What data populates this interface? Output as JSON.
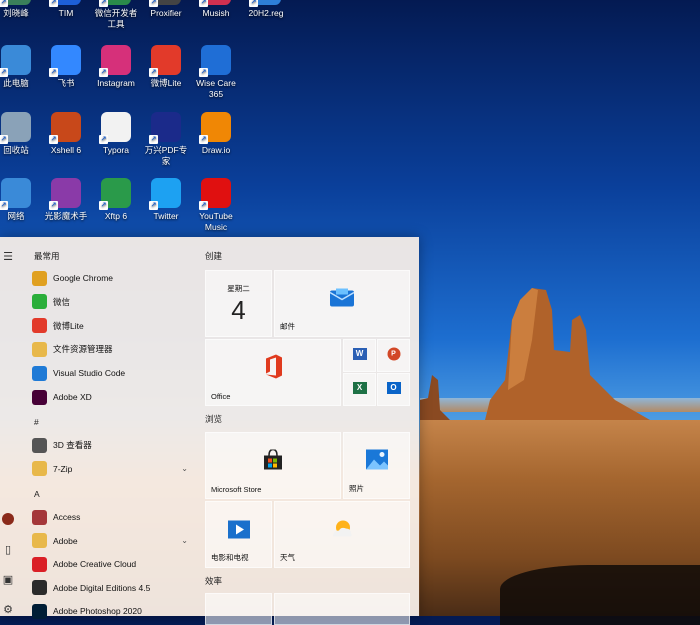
{
  "desktop": {
    "icons": [
      {
        "label": "刘晓峰",
        "icon": "user-folder-icon",
        "color": "#3a7f5a"
      },
      {
        "label": "TIM",
        "icon": "tim-icon",
        "color": "#1d5fd8"
      },
      {
        "label": "微信开发者工具",
        "icon": "wechat-devtools-icon",
        "color": "#2a8a4a"
      },
      {
        "label": "Proxifier",
        "icon": "proxifier-icon",
        "color": "#444444"
      },
      {
        "label": "Musish",
        "icon": "musish-icon",
        "color": "#d03050"
      },
      {
        "label": "20H2.reg",
        "icon": "reg-file-icon",
        "color": "#2e7fd8"
      },
      {
        "label": "此电脑",
        "icon": "computer-icon",
        "color": "#3a8ad8"
      },
      {
        "label": "飞书",
        "icon": "feishu-icon",
        "color": "#3388ff"
      },
      {
        "label": "Instagram",
        "icon": "instagram-icon",
        "color": "#d6307a"
      },
      {
        "label": "微博Lite",
        "icon": "weibo-icon",
        "color": "#e23a2a"
      },
      {
        "label": "Wise Care 365",
        "icon": "wise-care-icon",
        "color": "#1f6ed6"
      },
      {
        "label": "回收站",
        "icon": "recycle-bin-icon",
        "color": "#8aa2b8"
      },
      {
        "label": "Xshell 6",
        "icon": "xshell-icon",
        "color": "#c8481a"
      },
      {
        "label": "Typora",
        "icon": "typora-icon",
        "color": "#f2f2f2"
      },
      {
        "label": "万兴PDF专家",
        "icon": "pdf-icon",
        "color": "#1b2a8a"
      },
      {
        "label": "Draw.io",
        "icon": "drawio-icon",
        "color": "#f08705"
      },
      {
        "label": "网络",
        "icon": "network-icon",
        "color": "#3a8ad8"
      },
      {
        "label": "光影魔术手",
        "icon": "neoimaging-icon",
        "color": "#8a3aa8"
      },
      {
        "label": "Xftp 6",
        "icon": "xftp-icon",
        "color": "#2a9a4a"
      },
      {
        "label": "Twitter",
        "icon": "twitter-icon",
        "color": "#1da1f2"
      },
      {
        "label": "YouTube Music",
        "icon": "youtube-music-icon",
        "color": "#e01010"
      }
    ]
  },
  "start_menu": {
    "section_frequent": "最常用",
    "frequent": [
      {
        "label": "Google Chrome",
        "icon": "chrome-icon",
        "color": "#e0a020"
      },
      {
        "label": "微信",
        "icon": "wechat-icon",
        "color": "#2aae3a"
      },
      {
        "label": "微博Lite",
        "icon": "weibo-icon",
        "color": "#e23a2a"
      },
      {
        "label": "文件资源管理器",
        "icon": "folder-icon",
        "color": "#e8b84a"
      },
      {
        "label": "Visual Studio Code",
        "icon": "vscode-icon",
        "color": "#1f7ad6"
      },
      {
        "label": "Adobe XD",
        "icon": "adobe-xd-icon",
        "color": "#470137"
      }
    ],
    "hash_header": "#",
    "hash_apps": [
      {
        "label": "3D 查看器",
        "icon": "3d-viewer-icon",
        "color": "#555555"
      },
      {
        "label": "7-Zip",
        "icon": "folder-icon",
        "color": "#e8b84a"
      }
    ],
    "a_header": "A",
    "a_apps": [
      {
        "label": "Access",
        "icon": "access-icon",
        "color": "#a4373a"
      },
      {
        "label": "Adobe",
        "icon": "folder-icon",
        "color": "#e8b84a"
      },
      {
        "label": "Adobe Creative Cloud",
        "icon": "creative-cloud-icon",
        "color": "#da1f26"
      },
      {
        "label": "Adobe Digital Editions 4.5",
        "icon": "digital-editions-icon",
        "color": "#2b2b2b"
      },
      {
        "label": "Adobe Photoshop 2020",
        "icon": "photoshop-icon",
        "color": "#001e36"
      }
    ],
    "groups": {
      "create": "创建",
      "browse": "浏览",
      "efficiency": "效率"
    },
    "tiles": {
      "calendar_day": "星期二",
      "calendar_date": "4",
      "mail": "邮件",
      "office": "Office",
      "store": "Microsoft Store",
      "photos": "照片",
      "movies": "电影和电视",
      "weather": "天气"
    }
  }
}
